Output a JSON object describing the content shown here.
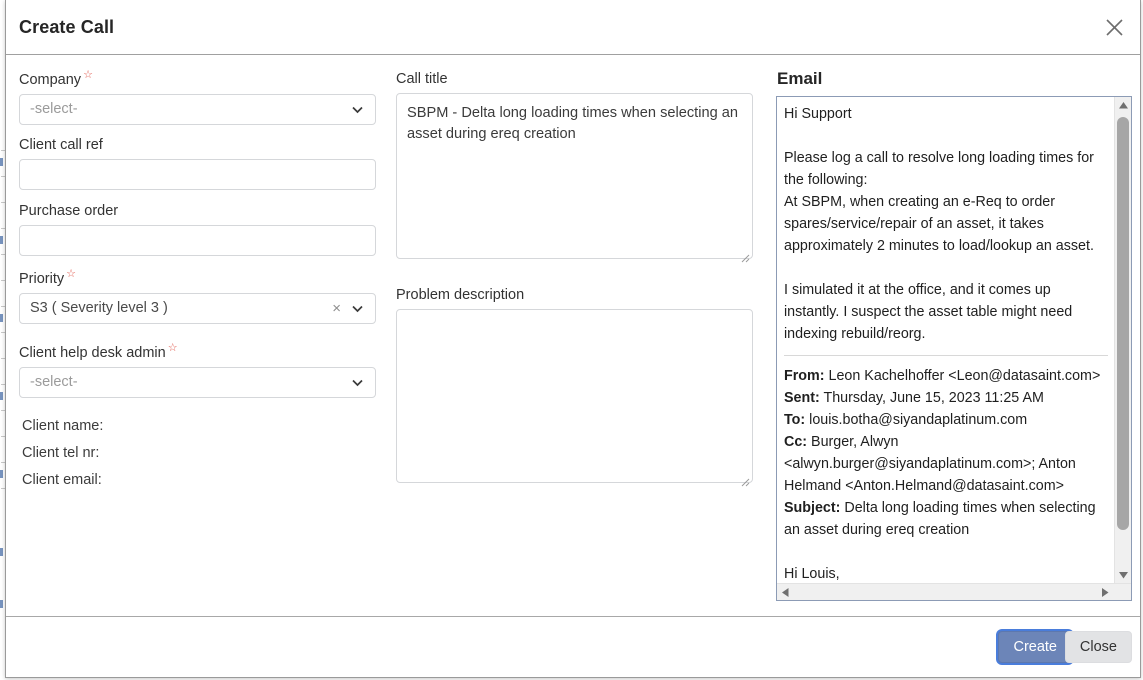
{
  "dialog": {
    "title": "Create Call",
    "close_icon": "close-icon"
  },
  "form": {
    "company": {
      "label": "Company",
      "required_marker": "☆",
      "value": "",
      "placeholder": "-select-",
      "chevron_icon": "chevron-down-icon"
    },
    "client_call_ref": {
      "label": "Client call ref",
      "value": "",
      "placeholder": ""
    },
    "purchase_order": {
      "label": "Purchase order",
      "value": "",
      "placeholder": ""
    },
    "priority": {
      "label": "Priority",
      "required_marker": "☆",
      "value": "S3 ( Severity level 3 )",
      "clear_icon": "×",
      "chevron_icon": "chevron-down-icon"
    },
    "client_help_desk_admin": {
      "label": "Client help desk admin",
      "required_marker": "☆",
      "value": "",
      "placeholder": "-select-",
      "chevron_icon": "chevron-down-icon"
    },
    "client_name": {
      "label": "Client name:",
      "value": ""
    },
    "client_tel_nr": {
      "label": "Client tel nr:",
      "value": ""
    },
    "client_email": {
      "label": "Client email:",
      "value": ""
    },
    "call_title": {
      "label": "Call title",
      "value": "SBPM - Delta long loading times when selecting an asset during ereq creation",
      "placeholder": ""
    },
    "problem_description": {
      "label": "Problem description",
      "value": "",
      "placeholder": ""
    }
  },
  "email": {
    "title": "Email",
    "greeting": "Hi Support",
    "paragraph_1": "Please log a call to resolve long loading times for the following:",
    "paragraph_2": "At SBPM, when creating an e-Req to order spares/service/repair of an asset, it takes approximately 2 minutes to load/lookup an asset.",
    "paragraph_3": "I simulated it at the office, and it comes up instantly. I suspect the asset table might need indexing rebuild/reorg.",
    "headers": {
      "from_label": "From:",
      "from_value": "Leon Kachelhoffer <Leon@datasaint.com>",
      "sent_label": "Sent:",
      "sent_value": "Thursday, June 15, 2023 11:25 AM",
      "to_label": "To:",
      "to_value": "louis.botha@siyandaplatinum.com",
      "cc_label": "Cc:",
      "cc_value": "Burger, Alwyn <alwyn.burger@siyandaplatinum.com>; Anton Helmand <Anton.Helmand@datasaint.com>",
      "subject_label": "Subject:",
      "subject_value": "Delta long loading times when selecting an asset during ereq creation"
    },
    "closing_greeting": "Hi Louis,",
    "scrollbar": {
      "up_arrow_icon": "scroll-up-arrow-icon",
      "down_arrow_icon": "scroll-down-arrow-icon",
      "left_arrow_icon": "scroll-left-arrow-icon",
      "right_arrow_icon": "scroll-right-arrow-icon"
    }
  },
  "footer": {
    "create_label": "Create",
    "close_label": "Close"
  },
  "colors": {
    "create_button": "#6c85b8",
    "create_focus_ring": "#4a7ddb",
    "close_button": "#e2e3e5",
    "required_star": "#e0574b",
    "email_border": "#8c9bb5",
    "scrollbar_thumb": "#a6a6a6"
  }
}
